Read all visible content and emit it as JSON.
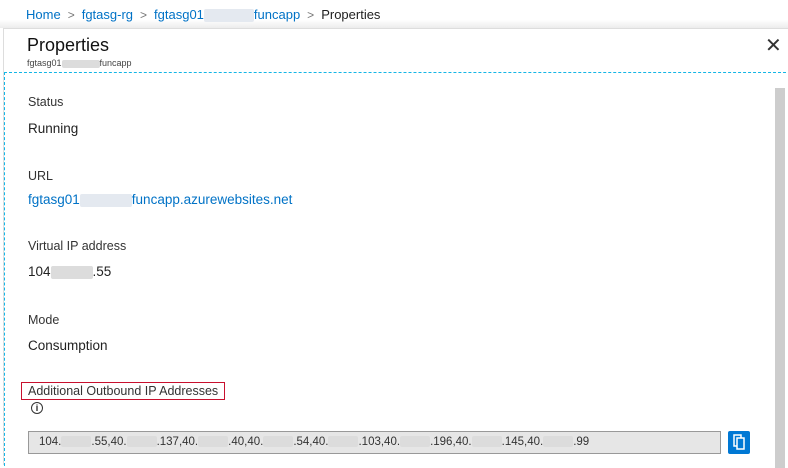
{
  "breadcrumb": {
    "items": [
      "Home",
      "fgtasg-rg",
      "fgtasg01",
      "funcapp"
    ],
    "current": "Properties"
  },
  "header": {
    "title": "Properties",
    "subtitle_prefix": "fgtasg01",
    "subtitle_suffix": "funcapp"
  },
  "fields": {
    "status": {
      "label": "Status",
      "value": "Running"
    },
    "url": {
      "label": "URL",
      "value_prefix": "fgtasg01",
      "value_suffix": "funcapp.azurewebsites.net"
    },
    "vip": {
      "label": "Virtual IP address",
      "value_prefix": "104",
      "value_suffix": ".55"
    },
    "mode": {
      "label": "Mode",
      "value": "Consumption"
    },
    "outbound": {
      "label": "Additional Outbound IP Addresses",
      "segments": [
        "104.",
        ".55,40.",
        ".137,40.",
        ".40,40.",
        ".54,40.",
        ".103,40.",
        ".196,40.",
        ".145,40.",
        ".99"
      ]
    }
  }
}
